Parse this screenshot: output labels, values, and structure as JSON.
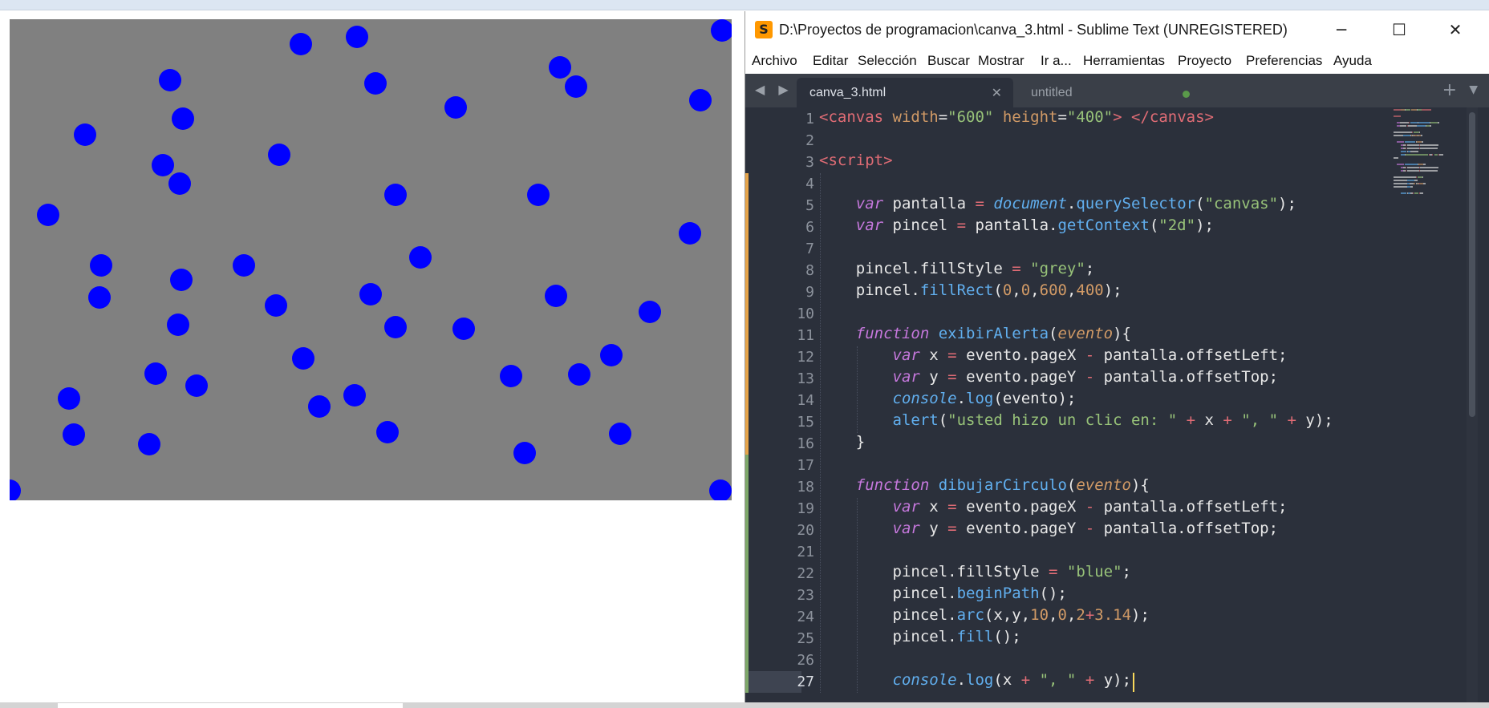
{
  "canvas": {
    "background": "#808080",
    "dot_color": "#0000ff"
  },
  "editor": {
    "window_title": "D:\\Proyectos de programacion\\canva_3.html - Sublime Text (UNREGISTERED)",
    "app_icon": "sublime-text-icon",
    "app_icon_glyph": "S",
    "window_controls": {
      "minimize": "─",
      "maximize": "☐",
      "close": "✕"
    },
    "menu": [
      "Archivo",
      "Editar",
      "Selección",
      "Buscar",
      "Mostrar",
      "Ir a...",
      "Herramientas",
      "Proyecto",
      "Preferencias",
      "Ayuda"
    ],
    "tab_nav": "◀ ▶",
    "tabs": [
      {
        "label": "canva_3.html",
        "active": true,
        "close": "✕"
      },
      {
        "label": "untitled",
        "active": false
      }
    ],
    "tab_actions": {
      "add": "+",
      "menu": "▼"
    },
    "current_line": 27,
    "line_numbers": [
      "1",
      "2",
      "3",
      "4",
      "5",
      "6",
      "7",
      "8",
      "9",
      "10",
      "11",
      "12",
      "13",
      "14",
      "15",
      "16",
      "17",
      "18",
      "19",
      "20",
      "21",
      "22",
      "23",
      "24",
      "25",
      "26",
      "27"
    ],
    "colors": {
      "background": "#2b303b",
      "tag": "#e06c75",
      "string": "#98c379",
      "keyword": "#c678dd",
      "function": "#61afef",
      "number": "#d19a66",
      "operator": "#e06c75",
      "plain": "#e8e8e8",
      "change_modified": "#e5a44a",
      "change_added": "#7ea86a"
    },
    "code_lines": [
      [
        [
          "tag",
          "<canvas "
        ],
        [
          "attr",
          "width"
        ],
        [
          "plain",
          "="
        ],
        [
          "string",
          "\"600\""
        ],
        [
          "plain",
          " "
        ],
        [
          "attr",
          "height"
        ],
        [
          "plain",
          "="
        ],
        [
          "string",
          "\"400\""
        ],
        [
          "tag",
          "> </canvas>"
        ]
      ],
      [],
      [
        [
          "tag",
          "<script>"
        ]
      ],
      [],
      [
        [
          "plain",
          "    "
        ],
        [
          "keyword",
          "var"
        ],
        [
          "plain",
          " pantalla "
        ],
        [
          "op",
          "="
        ],
        [
          "plain",
          " "
        ],
        [
          "builtin",
          "document"
        ],
        [
          "plain",
          "."
        ],
        [
          "function",
          "querySelector"
        ],
        [
          "plain",
          "("
        ],
        [
          "string",
          "\"canvas\""
        ],
        [
          "plain",
          ");"
        ]
      ],
      [
        [
          "plain",
          "    "
        ],
        [
          "keyword",
          "var"
        ],
        [
          "plain",
          " pincel "
        ],
        [
          "op",
          "="
        ],
        [
          "plain",
          " pantalla."
        ],
        [
          "function",
          "getContext"
        ],
        [
          "plain",
          "("
        ],
        [
          "string",
          "\"2d\""
        ],
        [
          "plain",
          ");"
        ]
      ],
      [],
      [
        [
          "plain",
          "    pincel.fillStyle "
        ],
        [
          "op",
          "="
        ],
        [
          "plain",
          " "
        ],
        [
          "string",
          "\"grey\""
        ],
        [
          "plain",
          ";"
        ]
      ],
      [
        [
          "plain",
          "    pincel."
        ],
        [
          "function",
          "fillRect"
        ],
        [
          "plain",
          "("
        ],
        [
          "number",
          "0"
        ],
        [
          "plain",
          ","
        ],
        [
          "number",
          "0"
        ],
        [
          "plain",
          ","
        ],
        [
          "number",
          "600"
        ],
        [
          "plain",
          ","
        ],
        [
          "number",
          "400"
        ],
        [
          "plain",
          ");"
        ]
      ],
      [],
      [
        [
          "plain",
          "    "
        ],
        [
          "keyword",
          "function"
        ],
        [
          "plain",
          " "
        ],
        [
          "fname",
          "exibirAlerta"
        ],
        [
          "plain",
          "("
        ],
        [
          "param",
          "evento"
        ],
        [
          "plain",
          "){"
        ]
      ],
      [
        [
          "plain",
          "        "
        ],
        [
          "keyword",
          "var"
        ],
        [
          "plain",
          " x "
        ],
        [
          "op",
          "="
        ],
        [
          "plain",
          " evento.pageX "
        ],
        [
          "op",
          "-"
        ],
        [
          "plain",
          " pantalla.offsetLeft;"
        ]
      ],
      [
        [
          "plain",
          "        "
        ],
        [
          "keyword",
          "var"
        ],
        [
          "plain",
          " y "
        ],
        [
          "op",
          "="
        ],
        [
          "plain",
          " evento.pageY "
        ],
        [
          "op",
          "-"
        ],
        [
          "plain",
          " pantalla.offsetTop;"
        ]
      ],
      [
        [
          "plain",
          "        "
        ],
        [
          "builtin",
          "console"
        ],
        [
          "plain",
          "."
        ],
        [
          "function",
          "log"
        ],
        [
          "plain",
          "(evento);"
        ]
      ],
      [
        [
          "plain",
          "        "
        ],
        [
          "function",
          "alert"
        ],
        [
          "plain",
          "("
        ],
        [
          "string",
          "\"usted hizo un clic en: \""
        ],
        [
          "plain",
          " "
        ],
        [
          "op",
          "+"
        ],
        [
          "plain",
          " x "
        ],
        [
          "op",
          "+"
        ],
        [
          "plain",
          " "
        ],
        [
          "string",
          "\", \""
        ],
        [
          "plain",
          " "
        ],
        [
          "op",
          "+"
        ],
        [
          "plain",
          " y);"
        ]
      ],
      [
        [
          "plain",
          "    }"
        ]
      ],
      [],
      [
        [
          "plain",
          "    "
        ],
        [
          "keyword",
          "function"
        ],
        [
          "plain",
          " "
        ],
        [
          "fname",
          "dibujarCirculo"
        ],
        [
          "plain",
          "("
        ],
        [
          "param",
          "evento"
        ],
        [
          "plain",
          "){"
        ]
      ],
      [
        [
          "plain",
          "        "
        ],
        [
          "keyword",
          "var"
        ],
        [
          "plain",
          " x "
        ],
        [
          "op",
          "="
        ],
        [
          "plain",
          " evento.pageX "
        ],
        [
          "op",
          "-"
        ],
        [
          "plain",
          " pantalla.offsetLeft;"
        ]
      ],
      [
        [
          "plain",
          "        "
        ],
        [
          "keyword",
          "var"
        ],
        [
          "plain",
          " y "
        ],
        [
          "op",
          "="
        ],
        [
          "plain",
          " evento.pageY "
        ],
        [
          "op",
          "-"
        ],
        [
          "plain",
          " pantalla.offsetTop;"
        ]
      ],
      [],
      [
        [
          "plain",
          "        pincel.fillStyle "
        ],
        [
          "op",
          "="
        ],
        [
          "plain",
          " "
        ],
        [
          "string",
          "\"blue\""
        ],
        [
          "plain",
          ";"
        ]
      ],
      [
        [
          "plain",
          "        pincel."
        ],
        [
          "function",
          "beginPath"
        ],
        [
          "plain",
          "();"
        ]
      ],
      [
        [
          "plain",
          "        pincel."
        ],
        [
          "function",
          "arc"
        ],
        [
          "plain",
          "(x,y,"
        ],
        [
          "number",
          "10"
        ],
        [
          "plain",
          ","
        ],
        [
          "number",
          "0"
        ],
        [
          "plain",
          ","
        ],
        [
          "number",
          "2"
        ],
        [
          "op",
          "+"
        ],
        [
          "number",
          "3.14"
        ],
        [
          "plain",
          ");"
        ]
      ],
      [
        [
          "plain",
          "        pincel."
        ],
        [
          "function",
          "fill"
        ],
        [
          "plain",
          "();"
        ]
      ],
      [],
      [
        [
          "plain",
          "        "
        ],
        [
          "builtin",
          "console"
        ],
        [
          "plain",
          "."
        ],
        [
          "function",
          "log"
        ],
        [
          "plain",
          "(x "
        ],
        [
          "op",
          "+"
        ],
        [
          "plain",
          " "
        ],
        [
          "string",
          "\", \""
        ],
        [
          "plain",
          " "
        ],
        [
          "op",
          "+"
        ],
        [
          "plain",
          " y);"
        ]
      ]
    ]
  }
}
